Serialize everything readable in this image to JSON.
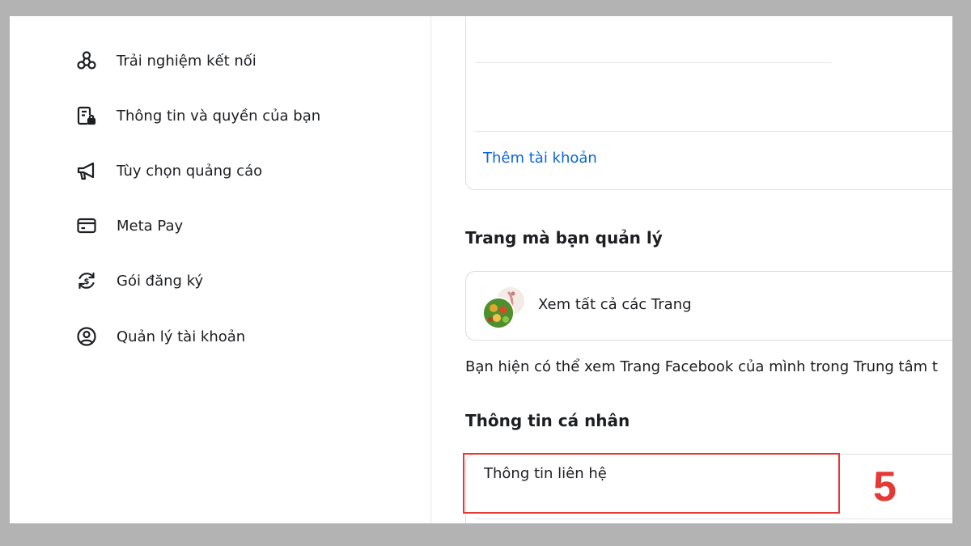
{
  "sidebar": {
    "items": [
      {
        "label": "Trải nghiệm kết nối",
        "icon": "connected-experiences-icon"
      },
      {
        "label": "Thông tin và quyền của bạn",
        "icon": "information-permissions-icon"
      },
      {
        "label": "Tùy chọn quảng cáo",
        "icon": "megaphone-icon"
      },
      {
        "label": "Meta Pay",
        "icon": "credit-card-icon"
      },
      {
        "label": "Gói đăng ký",
        "icon": "subscription-icon"
      },
      {
        "label": "Quản lý tài khoản",
        "icon": "user-circle-icon"
      }
    ]
  },
  "accounts": {
    "add_account": "Thêm tài khoản"
  },
  "pages": {
    "title": "Trang mà bạn quản lý",
    "see_all": "Xem tất cả các Trang",
    "info_text": "Bạn hiện có thể xem Trang Facebook của mình trong Trung tâm t"
  },
  "personal": {
    "title": "Thông tin cá nhân",
    "contact_info": "Thông tin liên hệ"
  },
  "annotation": {
    "step": "5",
    "color": "#e53935"
  },
  "colors": {
    "link": "#0a66d9",
    "backdrop": "#b3b3b3"
  }
}
